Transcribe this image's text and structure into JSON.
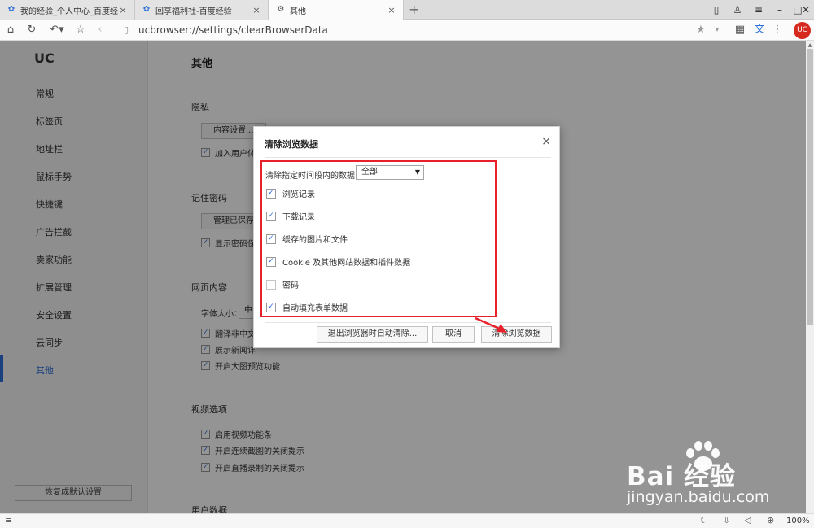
{
  "tabs": [
    {
      "label": "我的经验_个人中心_百度经验",
      "icon": "baidu-paw-icon",
      "active": false
    },
    {
      "label": "回享福利社-百度经验",
      "icon": "baidu-paw-icon",
      "active": false
    },
    {
      "label": "其他",
      "icon": "gear-icon",
      "active": true
    }
  ],
  "new_tab": "+",
  "address": {
    "url": "ucbrowser://settings/clearBrowserData"
  },
  "brand_badge": "UC",
  "sidebar": {
    "logo": "UC",
    "items": [
      {
        "label": "常规"
      },
      {
        "label": "标签页"
      },
      {
        "label": "地址栏"
      },
      {
        "label": "鼠标手势"
      },
      {
        "label": "快捷键"
      },
      {
        "label": "广告拦截"
      },
      {
        "label": "卖家功能"
      },
      {
        "label": "扩展管理"
      },
      {
        "label": "安全设置"
      },
      {
        "label": "云同步"
      },
      {
        "label": "其他"
      }
    ],
    "active_item": "其他",
    "reset_button": "恢复成默认设置"
  },
  "main": {
    "title": "其他",
    "privacy": {
      "heading": "隐私",
      "content_settings_button": "内容设置...",
      "checkbox_label": "加入用户体"
    },
    "passwords": {
      "heading": "记住密码",
      "manage_button": "管理已保存",
      "checkbox_label": "显示密码保"
    },
    "web_content": {
      "heading": "网页内容",
      "font_size_label": "字体大小：",
      "font_size_value": "中",
      "checks": [
        "翻译非中文",
        "展示新闻详",
        "开启大图预览功能"
      ]
    },
    "video": {
      "heading": "视频选项",
      "checks": [
        "启用视频功能条",
        "开启连续截图的关闭提示",
        "开启直播录制的关闭提示"
      ]
    },
    "user_data_heading": "用户数据"
  },
  "dialog": {
    "title": "清除浏览数据",
    "close": "×",
    "range_label": "清除指定时间段内的数据：",
    "range_value": "全部",
    "options": [
      {
        "label": "浏览记录",
        "checked": true
      },
      {
        "label": "下载记录",
        "checked": true
      },
      {
        "label": "缓存的图片和文件",
        "checked": true
      },
      {
        "label": "Cookie 及其他网站数据和插件数据",
        "checked": true
      },
      {
        "label": "密码",
        "checked": false
      },
      {
        "label": "自动填充表单数据",
        "checked": true
      }
    ],
    "auto_clear_button": "退出浏览器时自动清除...",
    "cancel_button": "取消",
    "clear_button": "清除浏览数据"
  },
  "statusbar": {
    "zoom": "100%"
  },
  "watermark": {
    "logo": "Bai 经验",
    "url": "jingyan.baidu.com"
  },
  "colors": {
    "accent": "#2d6fd8",
    "highlight": "#e8202a",
    "badge": "#d62a1e"
  }
}
